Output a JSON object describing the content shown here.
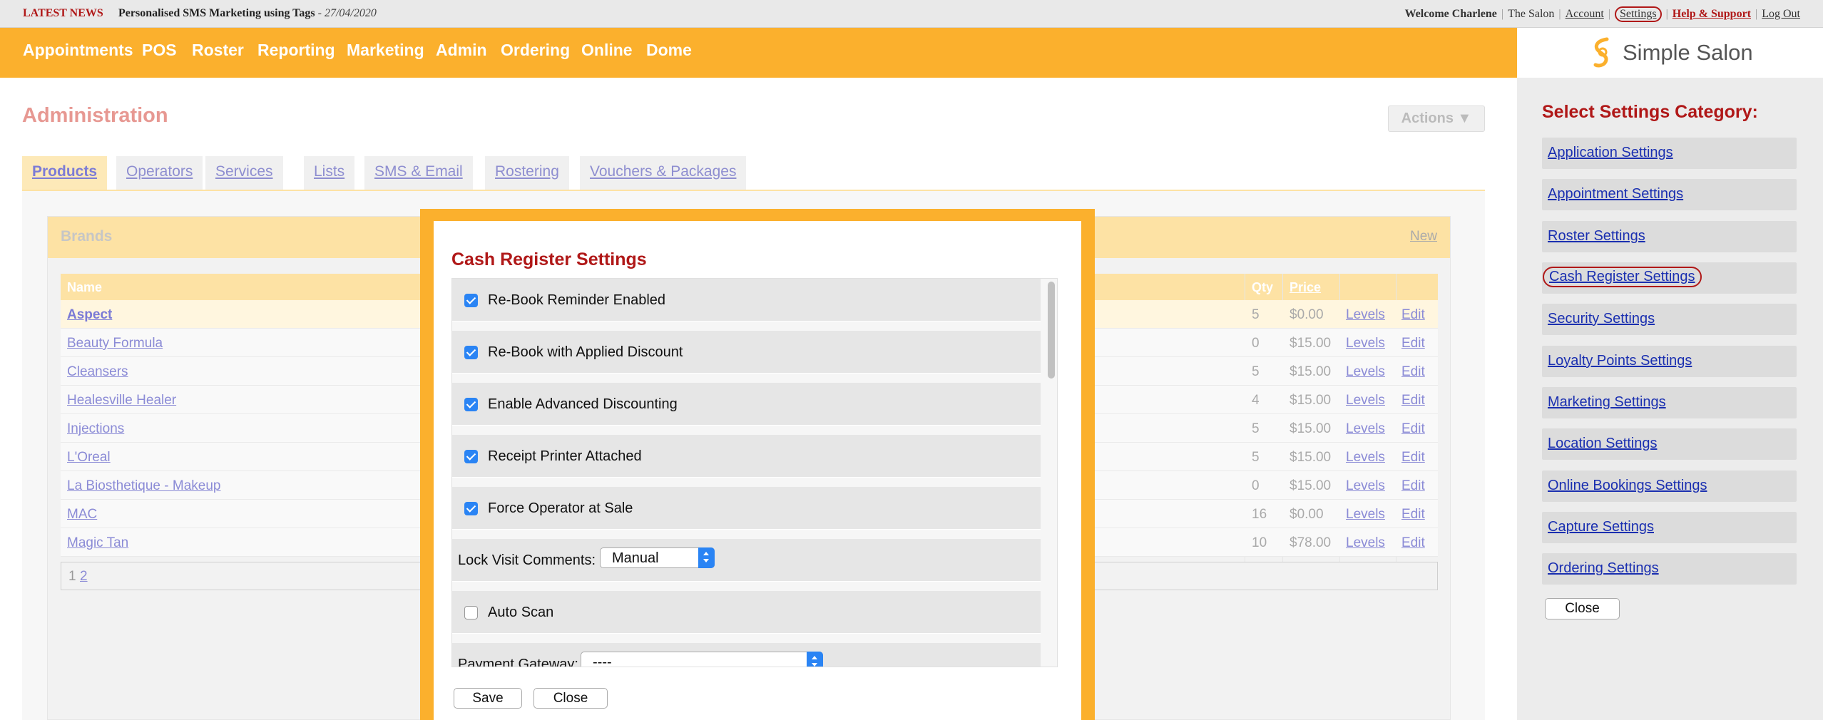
{
  "topbar": {
    "news_label": "LATEST NEWS",
    "news_text": "Personalised SMS Marketing using Tags",
    "news_date": "- 27/04/2020",
    "welcome": "Welcome Charlene",
    "salon": "The Salon",
    "account": "Account",
    "settings": "Settings",
    "help": "Help & Support",
    "logout": "Log Out"
  },
  "nav": [
    "Appointments",
    "POS",
    "Roster",
    "Reporting",
    "Marketing",
    "Admin",
    "Ordering",
    "Online",
    "Dome"
  ],
  "logo": {
    "text": "Simple Salon",
    "icon": "simple-salon-logo-icon",
    "color": "#fbb02d"
  },
  "admin": {
    "title": "Administration",
    "actions_label": "Actions ▼",
    "tabs": [
      "Products",
      "Operators",
      "Services",
      "Lists",
      "SMS & Email",
      "Rostering",
      "Vouchers & Packages"
    ],
    "active_tab": "Products"
  },
  "brands": {
    "title": "Brands",
    "new_label": "New",
    "columns": {
      "name": "Name",
      "qty": "Qty",
      "price": "Price"
    },
    "rows": [
      {
        "name": "Aspect",
        "qty": "5",
        "price": "$0.00",
        "levels": "Levels",
        "edit": "Edit"
      },
      {
        "name": "Beauty Formula",
        "qty": "0",
        "price": "$15.00",
        "levels": "Levels",
        "edit": "Edit"
      },
      {
        "name": "Cleansers",
        "qty": "5",
        "price": "$15.00",
        "levels": "Levels",
        "edit": "Edit"
      },
      {
        "name": "Healesville Healer",
        "qty": "4",
        "price": "$15.00",
        "levels": "Levels",
        "edit": "Edit"
      },
      {
        "name": "Injections",
        "qty": "5",
        "price": "$15.00",
        "levels": "Levels",
        "edit": "Edit"
      },
      {
        "name": "L'Oreal",
        "qty": "5",
        "price": "$15.00",
        "levels": "Levels",
        "edit": "Edit"
      },
      {
        "name": "La Biosthetique - Makeup",
        "qty": "0",
        "price": "$15.00",
        "levels": "Levels",
        "edit": "Edit"
      },
      {
        "name": "MAC",
        "qty": "16",
        "price": "$0.00",
        "levels": "Levels",
        "edit": "Edit"
      },
      {
        "name": "Magic Tan",
        "qty": "10",
        "price": "$78.00",
        "levels": "Levels",
        "edit": "Edit"
      }
    ],
    "pager": {
      "page1": "1",
      "page2": "2"
    }
  },
  "modal": {
    "title": "Cash Register Settings",
    "settings": [
      {
        "label": "Re-Book Reminder Enabled",
        "checked": true
      },
      {
        "label": "Re-Book with Applied Discount",
        "checked": true
      },
      {
        "label": "Enable Advanced Discounting",
        "checked": true
      },
      {
        "label": "Receipt Printer Attached",
        "checked": true
      },
      {
        "label": "Force Operator at Sale",
        "checked": true
      }
    ],
    "lock_visit": {
      "label": "Lock Visit Comments:",
      "value": "Manual"
    },
    "auto_scan": {
      "label": "Auto Scan",
      "checked": false
    },
    "payment_gateway": {
      "label": "Payment Gateway:",
      "value": "----"
    },
    "save_label": "Save",
    "close_label": "Close"
  },
  "side": {
    "heading": "Select Settings Category:",
    "categories": [
      "Application Settings",
      "Appointment Settings",
      "Roster Settings",
      "Cash Register Settings",
      "Security Settings",
      "Loyalty Points Settings",
      "Marketing Settings",
      "Location Settings",
      "Online Bookings Settings",
      "Capture Settings",
      "Ordering Settings"
    ],
    "active_category": "Cash Register Settings",
    "close_label": "Close"
  },
  "colors": {
    "accent": "#fbb02d",
    "heading_red": "#b01818",
    "link_blue": "#1a2fb0",
    "checkbox_blue": "#2a84f4"
  }
}
